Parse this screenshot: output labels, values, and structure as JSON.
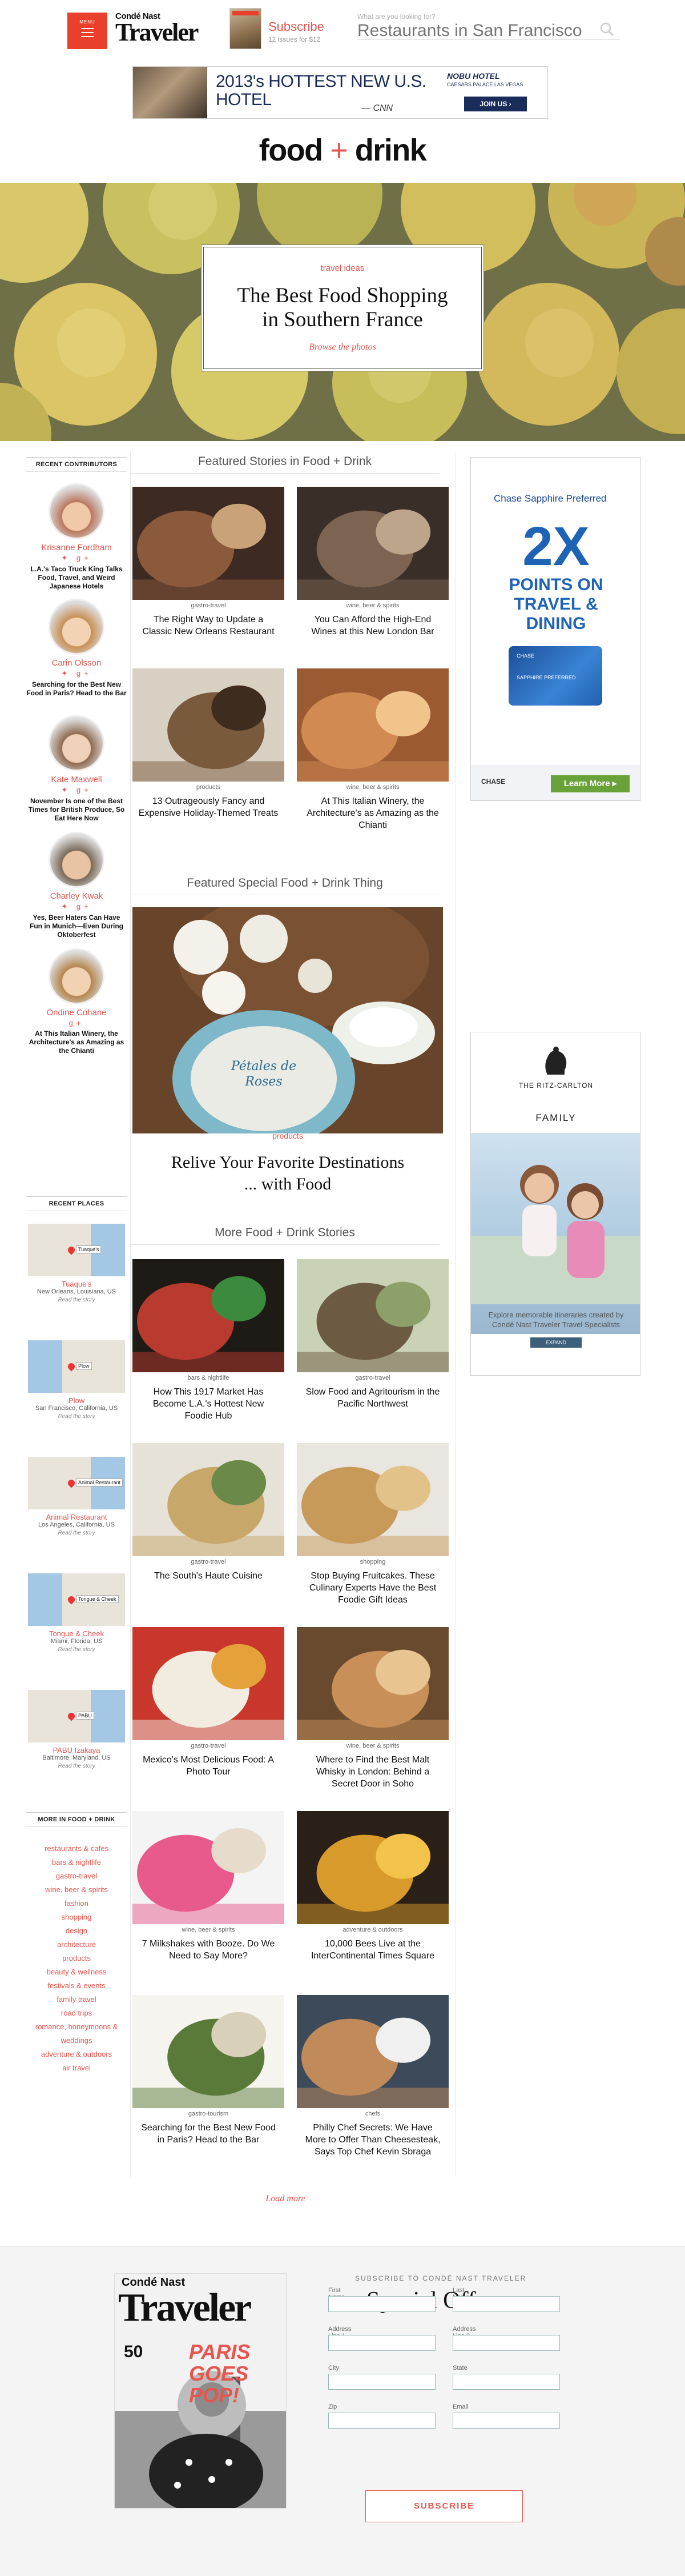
{
  "header": {
    "menu_label": "MENU",
    "logo_line1": "Condé Nast",
    "logo_line2": "Traveler",
    "subscribe_label": "Subscribe",
    "subscribe_sub": "12 issues for $12",
    "search_question": "What are you looking for?",
    "search_placeholder": "Restaurants in San Francisco"
  },
  "banner_ad": {
    "headline": "2013's HOTTEST NEW U.S. HOTEL",
    "attribution": "— CNN",
    "brand": "NOBU HOTEL",
    "brand_sub": "CAESARS PALACE LAS VEGAS",
    "cta": "JOIN US ›"
  },
  "section": {
    "title_a": "food",
    "title_plus": "+",
    "title_b": "drink"
  },
  "hero": {
    "category": "travel ideas",
    "title": "The Best Food Shopping in Southern France",
    "link": "Browse the photos"
  },
  "sidebar": {
    "contributors_heading": "RECENT CONTRIBUTORS",
    "contributors": [
      {
        "name": "Krisanne Fordham",
        "social": "✦ g+",
        "article": "L.A.'s Taco Truck King Talks Food, Travel, and Weird Japanese Hotels"
      },
      {
        "name": "Carin Olsson",
        "social": "✦ g+",
        "article": "Searching for the Best New Food in Paris? Head to the Bar"
      },
      {
        "name": "Kate Maxwell",
        "social": "✦ g+",
        "article": "November Is one of the Best Times for British Produce, So Eat Here Now"
      },
      {
        "name": "Charley Kwak",
        "social": "✦ g+",
        "article": "Yes, Beer Haters Can Have Fun in Munich—Even During Oktoberfest"
      },
      {
        "name": "Ondine Cohane",
        "social": "g+",
        "article": "At This Italian Winery, the Architecture's as Amazing as the Chianti"
      }
    ],
    "places_heading": "RECENT PLACES",
    "places": [
      {
        "name": "Tuaque's",
        "address": "New Orleans, Louisiana, US",
        "read": "Read the story",
        "map_label": "Tuaque's"
      },
      {
        "name": "Plow",
        "address": "San Francisco, California, US",
        "read": "Read the story",
        "map_label": "Plow"
      },
      {
        "name": "Animal Restaurant",
        "address": "Los Angeles, California, US",
        "read": "Read the story",
        "map_label": "Animal Restaurant"
      },
      {
        "name": "Tongue & Cheek",
        "address": "Miami, Florida, US",
        "read": "Read the story",
        "map_label": "Tongue & Cheek"
      },
      {
        "name": "PABU Izakaya",
        "address": "Baltimore, Maryland, US",
        "read": "Read the story",
        "map_label": "PABU"
      }
    ],
    "more_heading": "MORE IN FOOD + DRINK",
    "more_links": [
      "restaurants & cafes",
      "bars & nightlife",
      "gastro-travel",
      "wine, beer & spirits",
      "fashion",
      "shopping",
      "design",
      "architecture",
      "products",
      "beauty & wellness",
      "festivals & events",
      "family travel",
      "road trips",
      "romance, honeymoons & weddings",
      "adventure & outdoors",
      "air travel"
    ]
  },
  "featured_heading": "Featured Stories in Food + Drink",
  "featured": [
    {
      "category": "gastro-travel",
      "title": "The Right Way to Update a Classic New Orleans Restaurant"
    },
    {
      "category": "wine, beer & spirits",
      "title": "You Can Afford the High-End Wines at this New London Bar"
    },
    {
      "category": "products",
      "title": "13 Outrageously Fancy and Expensive Holiday-Themed Treats"
    },
    {
      "category": "wine, beer & spirits",
      "title": "At This Italian Winery, the Architecture's as Amazing as the Chianti"
    }
  ],
  "special_heading": "Featured Special Food + Drink Thing",
  "special": {
    "category": "products",
    "title": "Relive Your Favorite Destinations ... with Food"
  },
  "more_heading": "More Food + Drink Stories",
  "more_stories": [
    {
      "category": "bars & nightlife",
      "title": "How This 1917 Market Has Become L.A.'s Hottest New Foodie Hub"
    },
    {
      "category": "gastro-travel",
      "title": "Slow Food and Agritourism in the Pacific Northwest"
    },
    {
      "category": "gastro-travel",
      "title": "The South's Haute Cuisine"
    },
    {
      "category": "shopping",
      "title": "Stop Buying Fruitcakes. These Culinary Experts Have the Best Foodie Gift Ideas"
    },
    {
      "category": "gastro-travel",
      "title": "Mexico's Most Delicious Food: A Photo Tour"
    },
    {
      "category": "wine, beer & spirits",
      "title": "Where to Find the Best Malt Whisky in London: Behind a Secret Door in Soho"
    },
    {
      "category": "wine, beer & spirits",
      "title": "7 Milkshakes with Booze. Do We Need to Say More?"
    },
    {
      "category": "adventure & outdoors",
      "title": "10,000 Bees Live at the InterContinental Times Square"
    },
    {
      "category": "gastro-tourism",
      "title": "Searching for the Best New Food in Paris? Head to the Bar"
    },
    {
      "category": "chefs",
      "title": "Philly Chef Secrets: We Have More to Offer Than Cheesesteak, Says Top Chef Kevin Sbraga"
    }
  ],
  "load_more": "Load more",
  "chase_ad": {
    "brand": "Chase Sapphire Preferred",
    "big": "2X",
    "line": "POINTS ON TRAVEL & DINING",
    "card_brand": "CHASE",
    "card_name": "SAPPHIRE PREFERRED",
    "logo": "CHASE",
    "cta": "Learn More ▸"
  },
  "ritz_ad": {
    "name": "THE RITZ-CARLTON",
    "family": "FAMILY",
    "copy": "Explore memorable itineraries created by Condé Nast Traveler Travel Specialists",
    "cta": "EXPAND"
  },
  "footer": {
    "subheading": "SUBSCRIBE TO CONDÉ NAST TRAVELER",
    "title": "Special Offer",
    "cover_line1": "Condé Nast",
    "cover_line2": "Traveler",
    "cover_line3": "PARIS GOES POP!",
    "cover_num": "50",
    "fields": [
      "First Name",
      "Last Name",
      "Address Line 1",
      "Address Line 2",
      "City",
      "State",
      "Zip",
      "Email"
    ],
    "button": "SUBSCRIBE"
  },
  "colors": {
    "accent": "#e8554e",
    "menu_red": "#e8402d",
    "chase_blue": "#1e63b6"
  }
}
